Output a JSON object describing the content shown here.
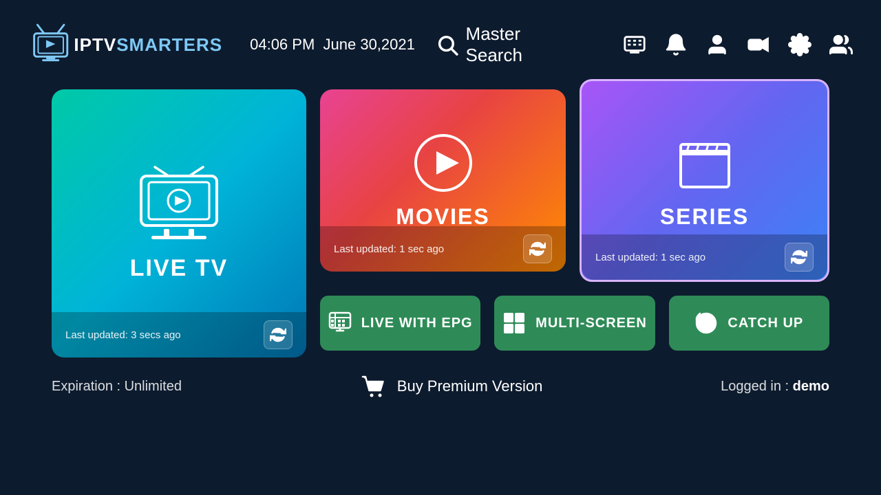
{
  "header": {
    "logo_iptv": "IPTV",
    "logo_smarters": "SMARTERS",
    "time": "04:06 PM",
    "date": "June 30,2021",
    "search_label": "Master Search"
  },
  "cards": {
    "live_tv": {
      "title": "LIVE TV",
      "last_updated": "Last updated: 3 secs ago"
    },
    "movies": {
      "title": "MOVIES",
      "last_updated": "Last updated: 1 sec ago"
    },
    "series": {
      "title": "SERIES",
      "last_updated": "Last updated: 1 sec ago"
    }
  },
  "buttons": {
    "live_epg": "LIVE WITH EPG",
    "multi_screen": "MULTI-SCREEN",
    "catch_up": "CATCH UP"
  },
  "footer": {
    "expiration": "Expiration : Unlimited",
    "buy_premium": "Buy Premium Version",
    "logged_in_label": "Logged in : ",
    "username": "demo"
  }
}
